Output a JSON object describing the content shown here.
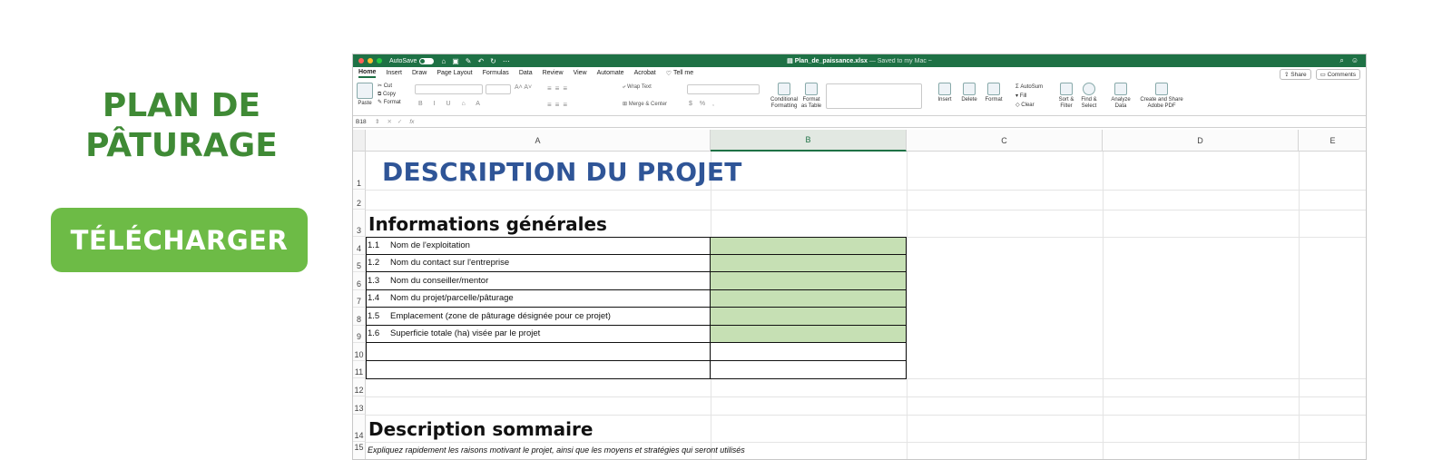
{
  "promo": {
    "title_line1": "PLAN DE",
    "title_line2": "PÂTURAGE",
    "download_label": "TÉLÉCHARGER",
    "accent_color": "#6dbb46",
    "title_color": "#3f8a35"
  },
  "window": {
    "autosave_label": "AutoSave",
    "autosave_state": "OFF",
    "filename": "Plan_de_paissance.xlsx",
    "saved_status": "— Saved to my Mac ~",
    "titlebar_color": "#1e7145"
  },
  "menu": {
    "tabs": [
      "Home",
      "Insert",
      "Draw",
      "Page Layout",
      "Formulas",
      "Data",
      "Review",
      "View",
      "Automate",
      "Acrobat",
      "Tell me"
    ],
    "share_label": "Share",
    "comments_label": "Comments"
  },
  "ribbon": {
    "paste": "Paste",
    "cut": "Cut",
    "copy": "Copy",
    "format_painter": "Format",
    "wrap_text": "Wrap Text",
    "merge_center": "Merge & Center",
    "conditional_formatting": "Conditional Formatting",
    "format_as_table": "Format as Table",
    "insert": "Insert",
    "delete": "Delete",
    "format": "Format",
    "autosum": "AutoSum",
    "fill": "Fill",
    "clear": "Clear",
    "sort_filter": "Sort & Filter",
    "find_select": "Find & Select",
    "analyze_data": "Analyze Data",
    "create_share_pdf": "Create and Share Adobe PDF"
  },
  "formula_bar": {
    "cell_ref": "B18",
    "fx": "fx",
    "content": ""
  },
  "sheet": {
    "columns": [
      "A",
      "B",
      "C",
      "D",
      "E"
    ],
    "selected_column": "B",
    "rows": [
      "1",
      "2",
      "3",
      "4",
      "5",
      "6",
      "7",
      "8",
      "9",
      "10",
      "11",
      "12",
      "13",
      "14",
      "15"
    ],
    "main_title": "DESCRIPTION DU PROJET",
    "section1_title": "Informations générales",
    "fields": [
      {
        "num": "1.1",
        "label": "Nom de l'exploitation"
      },
      {
        "num": "1.2",
        "label": "Nom du contact sur l'entreprise"
      },
      {
        "num": "1.3",
        "label": "Nom du conseiller/mentor"
      },
      {
        "num": "1.4",
        "label": "Nom du projet/parcelle/pâturage"
      },
      {
        "num": "1.5",
        "label": "Emplacement  (zone de pâturage désignée pour ce projet)"
      },
      {
        "num": "1.6",
        "label": "Superficie totale (ha) visée par le projet"
      }
    ],
    "section2_title": "Description sommaire",
    "section2_note": "Expliquez rapidement les raisons motivant le projet, ainsi que les moyens et stratégies qui seront utilisés",
    "input_fill_color": "#c6e0b4",
    "title_color": "#2f5597"
  }
}
